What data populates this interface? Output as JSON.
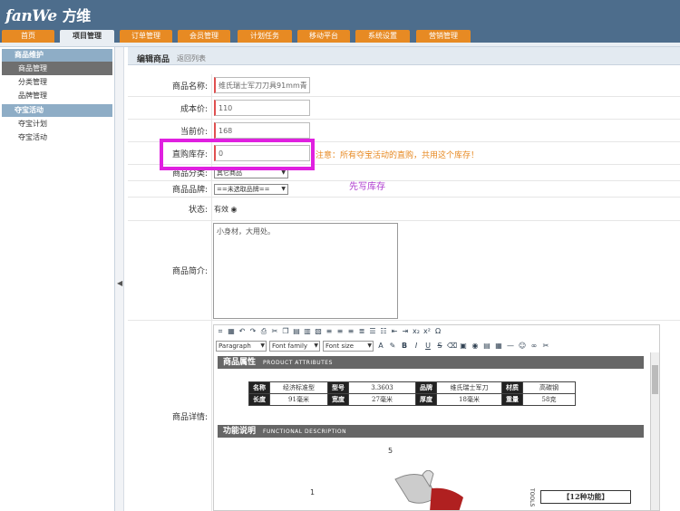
{
  "app": {
    "logo": "fanWe",
    "logo_cn": "方维"
  },
  "nav": [
    {
      "label": "首页"
    },
    {
      "label": "项目管理"
    },
    {
      "label": "订单管理"
    },
    {
      "label": "会员管理"
    },
    {
      "label": "计划任务"
    },
    {
      "label": "移动平台"
    },
    {
      "label": "系统设置"
    },
    {
      "label": "营销管理"
    }
  ],
  "sidebar": {
    "group1": "商品维护",
    "items1": [
      "商品管理",
      "分类管理",
      "品牌管理"
    ],
    "group2": "夺宝活动",
    "items2": [
      "夺宝计划",
      "夺宝活动"
    ]
  },
  "page": {
    "title": "编辑商品",
    "back_link": "返回列表"
  },
  "form": {
    "name_label": "商品名称:",
    "name_value": "维氏瑞士军刀刀具91mm青",
    "cost_label": "成本价:",
    "cost_value": "110",
    "price_label": "当前价:",
    "price_value": "168",
    "stock_label": "直购库存:",
    "stock_value": "0",
    "stock_note": "注意：所有夺宝活动的直购，共用这个库存！",
    "write_hint": "先写库存",
    "category_label": "商品分类:",
    "category_value": "其它商品",
    "brand_label": "商品品牌:",
    "brand_value": "==未选取品牌==",
    "status_label": "状态:",
    "status_value": "有效",
    "intro_label": "商品简介:",
    "intro_value": "小身材，大用处。",
    "detail_label": "商品详情:"
  },
  "editor": {
    "paragraph": "Paragraph",
    "font_family": "Font family",
    "font_size": "Font size",
    "section1": "商品属性",
    "section1_en": "PRODUCT ATTRIBUTES",
    "section2": "功能说明",
    "section2_en": "FUNCTIONAL DESCRIPTION",
    "attr_rows": [
      [
        "名称",
        "经济标准型",
        "型号",
        "3.3603",
        "品牌",
        "维氏瑞士军刀",
        "材质",
        "高碳钢"
      ],
      [
        "长度",
        "91毫米",
        "宽度",
        "27毫米",
        "厚度",
        "18毫米",
        "重量",
        "58克"
      ]
    ],
    "func_box": "【12种功能】",
    "num1": "5",
    "num2": "1",
    "tools": "TOOLS"
  }
}
